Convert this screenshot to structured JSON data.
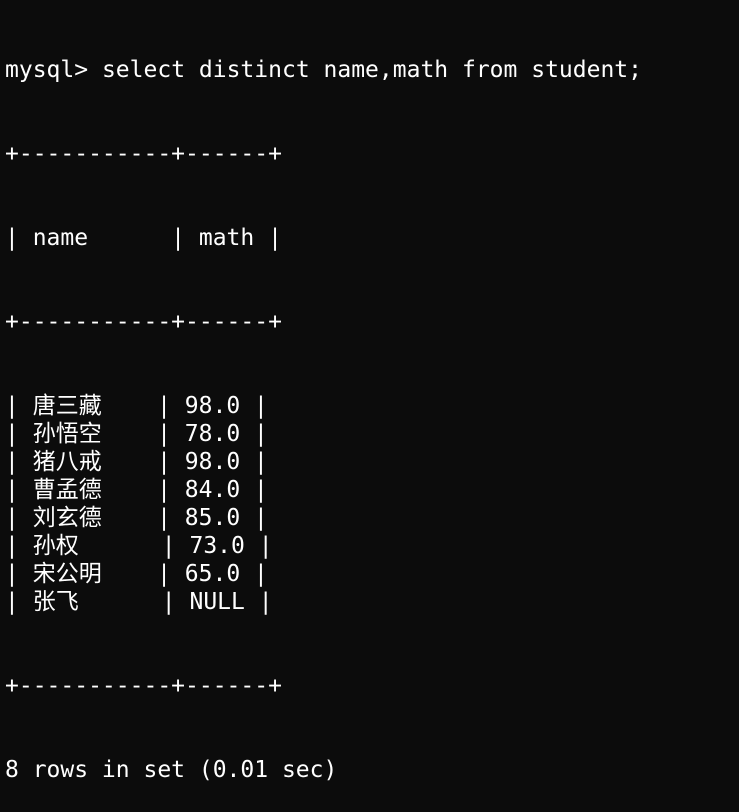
{
  "terminal": {
    "prompt": "mysql>",
    "command": "select distinct name,math from student;",
    "border": "+-----------+------+",
    "header": [
      "name",
      "math"
    ],
    "rows": [
      {
        "name": "唐三藏",
        "math": "98.0"
      },
      {
        "name": "孙悟空",
        "math": "78.0"
      },
      {
        "name": "猪八戒",
        "math": "98.0"
      },
      {
        "name": "曹孟德",
        "math": "84.0"
      },
      {
        "name": "刘玄德",
        "math": "85.0"
      },
      {
        "name": "孙权",
        "math": "73.0"
      },
      {
        "name": "宋公明",
        "math": "65.0"
      },
      {
        "name": "张飞",
        "math": "NULL"
      }
    ],
    "footer": "8 rows in set (0.01 sec)"
  },
  "colors": {
    "background": "#0c0c0c",
    "foreground": "#ffffff"
  }
}
